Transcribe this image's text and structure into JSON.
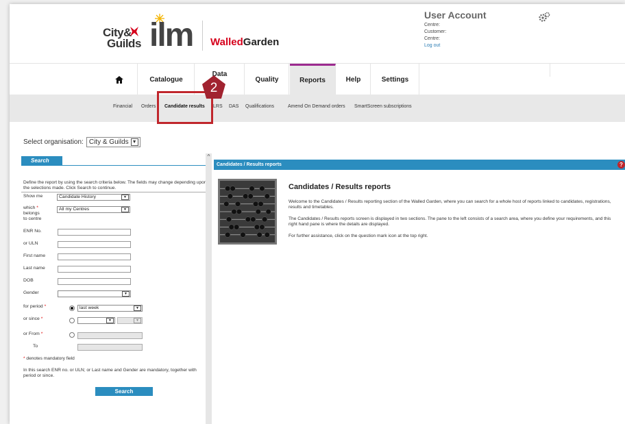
{
  "header": {
    "cg_logo_line1": "City&",
    "cg_logo_line2": "Guilds",
    "ilm_logo": "ilm",
    "walled": "Walled",
    "garden": "Garden",
    "user_account": {
      "title": "User Account",
      "centre1": "Centre:",
      "customer": "Customer:",
      "centre2": "Centre:",
      "logout": "Log out"
    }
  },
  "nav": {
    "home_icon": "home-icon",
    "items": [
      "Catalogue",
      "Data",
      "Quality",
      "Reports",
      "Help",
      "Settings"
    ],
    "active": "Reports"
  },
  "subnav": {
    "items": [
      "Financial",
      "Orders",
      "Candidate results",
      "LRS",
      "DAS",
      "Qualifications",
      "Amend On Demand orders",
      "SmartScreen subscriptions"
    ],
    "active": "Candidate results"
  },
  "callout": {
    "number": "2",
    "color": "#c0262c"
  },
  "org": {
    "label": "Select organisation:",
    "value": "City & Guilds"
  },
  "search_panel": {
    "tab": "Search",
    "description": "Define the report by using the search criteria below. The fields may change depending upon the selections made. Click Search to continue.",
    "show_me_label": "Show me",
    "show_me_value": "Candidate History",
    "which_label": "which",
    "belongs_label": "belongs",
    "to_centre_label": "to centre",
    "which_value": "All my Centres",
    "enr_label": "ENR No.",
    "uln_label": "or ULN",
    "first_name_label": "First name",
    "last_name_label": "Last name",
    "dob_label": "DOB",
    "gender_label": "Gender",
    "period_label": "for period",
    "period_value": "last week",
    "since_label": "or since",
    "from_label": "or From",
    "to_label": "To",
    "mandatory_note": "denotes mandatory field",
    "rule_note": "In this search ENR no. or ULN; or Last name and Gender are mandatory, together with period or since.",
    "search_button": "Search"
  },
  "results_panel": {
    "bar_title": "Candidates / Results reports",
    "help_icon": "question-mark-icon",
    "heading": "Candidates / Results reports",
    "p1": "Welcome to the Candidates / Results reporting section of the Walled Garden, where you can search for a whole host of reports linked to candidates, registrations, results and timetables.",
    "p2": "The Candidates / Results reports screen is displayed in two sections. The pane to the left consists of a search area, where you define your requirements, and this right hand pane is where the details are displayed.",
    "p3": "For further assistance, click on the question mark icon at the top right."
  },
  "colors": {
    "accent": "#2b8dbf",
    "brand_red": "#d6001c",
    "active_tab": "#9c2a8f"
  }
}
